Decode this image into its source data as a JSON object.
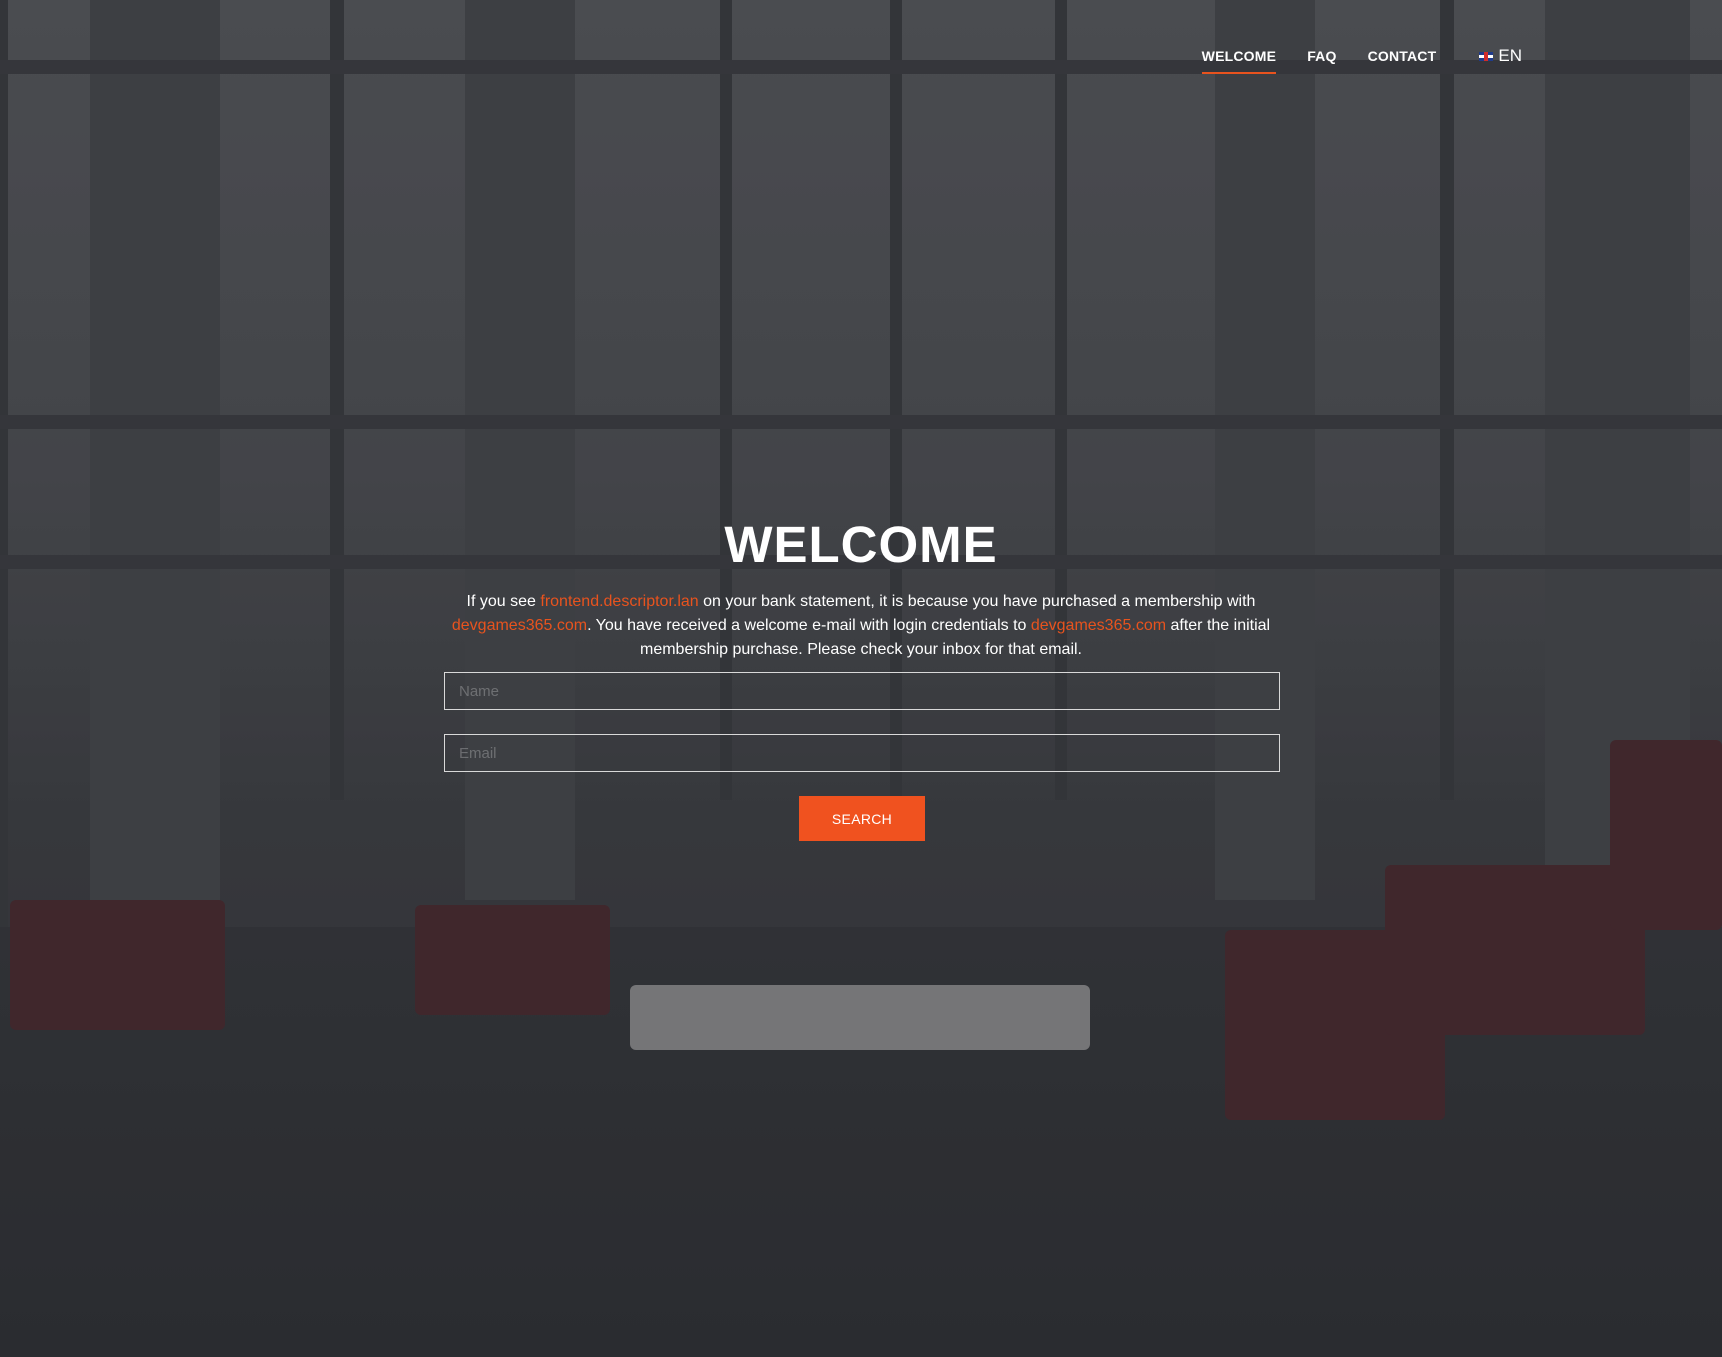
{
  "nav": {
    "items": [
      {
        "label": "WELCOME",
        "active": true
      },
      {
        "label": "FAQ",
        "active": false
      },
      {
        "label": "CONTACT",
        "active": false
      }
    ],
    "language": {
      "label": "EN",
      "flag": "uk-flag-icon"
    }
  },
  "hero": {
    "title": "WELCOME",
    "text_1": "If you see ",
    "link_1": "frontend.descriptor.lan",
    "text_2": " on your bank statement, it is because you have purchased a membership with ",
    "link_2": "devgames365.com",
    "text_3": ". You have received a welcome e-mail with login credentials to ",
    "link_3": "devgames365.com",
    "text_4": " after the initial membership purchase. Please check your inbox for that email."
  },
  "form": {
    "name_placeholder": "Name",
    "name_value": "",
    "email_placeholder": "Email",
    "email_value": "",
    "submit_label": "SEARCH"
  },
  "colors": {
    "accent": "#f0521f",
    "link": "#e8531e",
    "text": "#ffffff"
  }
}
